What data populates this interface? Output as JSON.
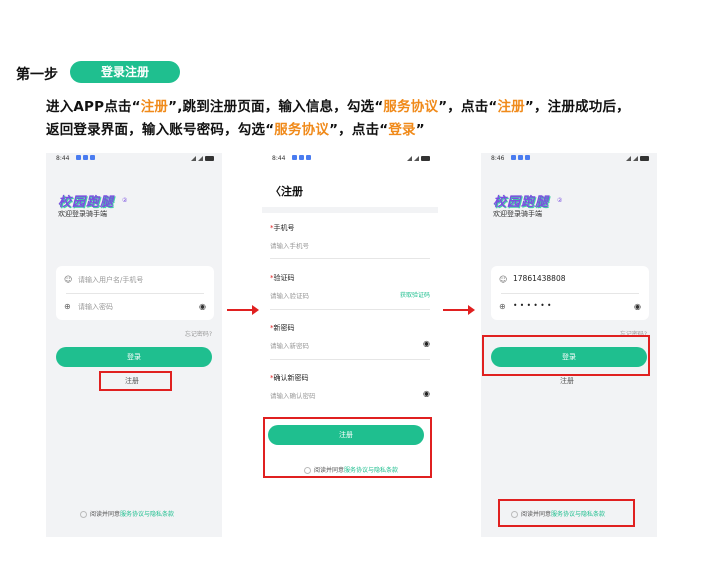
{
  "header": {
    "step": "第一步",
    "pill": "登录注册",
    "line1": {
      "p1": "进入APP点击“",
      "h1": "注册",
      "p2": "”,跳到注册页面，输入信息，勾选“",
      "h2": "服务协议",
      "p3": "”，点击“",
      "h3": "注册",
      "p4": "”，注册成功后，"
    },
    "line2": {
      "p1": "返回登录界面，输入账号密码，勾选“",
      "h1": "服务协议",
      "p2": "”，点击“",
      "h2": "登录",
      "p3": "”"
    }
  },
  "phone1": {
    "time": "8:44",
    "logo": "校园跑腿",
    "welcome": "欢迎登录骑手端",
    "username_placeholder": "请输入用户名/手机号",
    "password_placeholder": "请输入密码",
    "forgot": "忘记密码?",
    "login_button": "登录",
    "register_link": "注册",
    "agree_text": "阅读并同意",
    "agree_link": "服务协议与隐私条款"
  },
  "phone2": {
    "time": "8:44",
    "back_title": "注册",
    "phone_label": "手机号",
    "phone_placeholder": "请输入手机号",
    "code_label": "验证码",
    "code_placeholder": "请输入验证码",
    "get_code": "获取验证码",
    "newpw_label": "新密码",
    "newpw_placeholder": "请输入新密码",
    "confirm_label": "确认新密码",
    "confirm_placeholder": "请输入确认密码",
    "register_button": "注册",
    "agree_text": "阅读并同意",
    "agree_link": "服务协议与隐私条款"
  },
  "phone3": {
    "time": "8:46",
    "logo": "校园跑腿",
    "welcome": "欢迎登录骑手端",
    "username_value": "17861438808",
    "password_value": "• • • • • •",
    "forgot": "忘记密码?",
    "login_button": "登录",
    "register_link": "注册",
    "agree_text": "阅读并同意",
    "agree_link": "服务协议与隐私条款"
  },
  "colors": {
    "accent": "#1fbf8f",
    "highlight": "#f08a1a",
    "annotation": "#e02020",
    "logo": "#7a4fe0"
  },
  "icons": {
    "user": "user-icon",
    "lock": "lock-icon",
    "eye": "eye-icon",
    "back": "chevron-left-icon",
    "arrow": "arrow-right-icon"
  }
}
